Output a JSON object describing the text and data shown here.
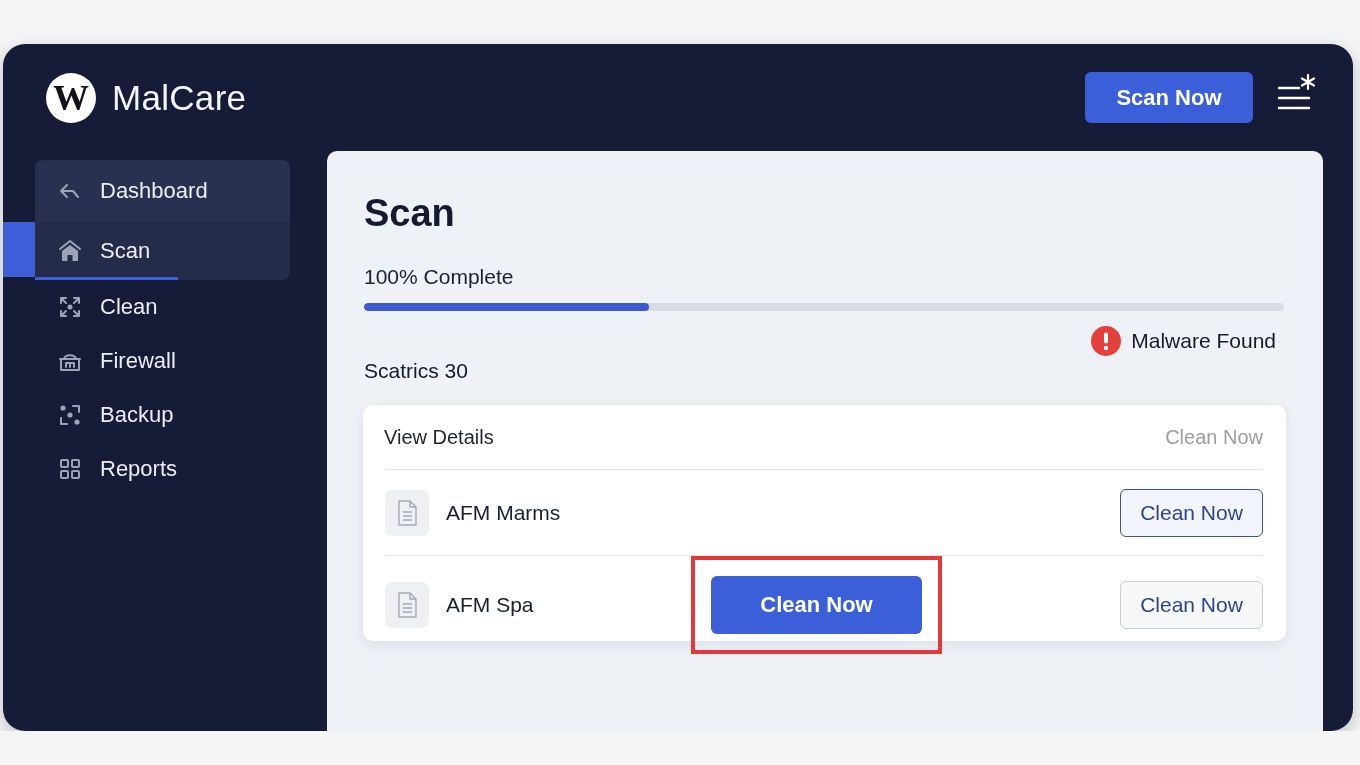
{
  "app": {
    "logo_letter": "W",
    "name": "MalCare"
  },
  "header": {
    "scan_button": {
      "label": "Scan Now"
    }
  },
  "sidebar": {
    "back_link": {
      "label": "Dashboard"
    },
    "items": [
      {
        "label": "Scan",
        "selected": true
      },
      {
        "label": "Clean",
        "selected": false
      },
      {
        "label": "Firewall",
        "selected": false
      },
      {
        "label": "Backup",
        "selected": false
      },
      {
        "label": "Reports",
        "selected": false
      }
    ]
  },
  "main": {
    "title": "Scan",
    "progress": {
      "label": "100% Complete",
      "level": 0.31
    },
    "status": {
      "text": "Malware Found"
    },
    "summary": "Scatrics 30",
    "results": {
      "header": {
        "title": "View Details",
        "action": {
          "label": "Clean Now",
          "disabled": true
        }
      },
      "rows": [
        {
          "name": "AFM Marms",
          "action": {
            "label": "Clean Now",
            "focused": true
          }
        },
        {
          "name": "AFM Spa",
          "highlight_button": {
            "label": "Clean Now",
            "highlighted": true
          },
          "action": {
            "label": "Clean Now",
            "focused": false
          }
        }
      ]
    }
  }
}
